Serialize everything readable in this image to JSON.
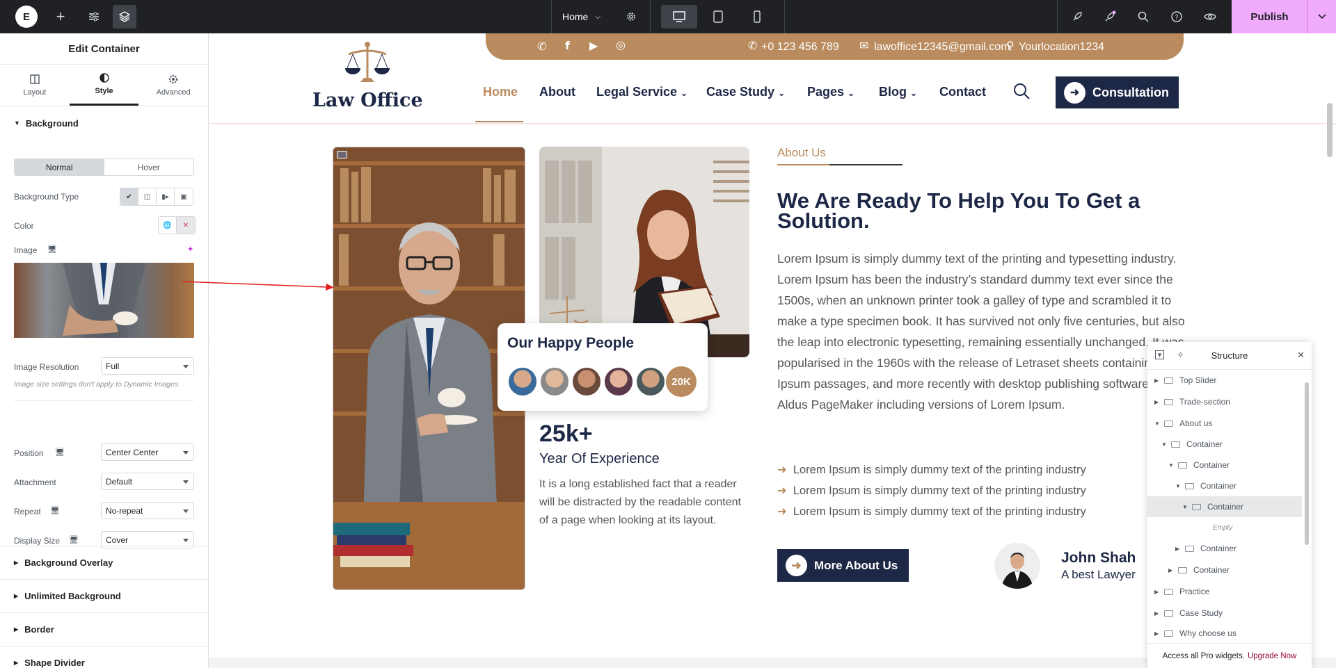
{
  "topbar": {
    "logo": "E",
    "page_name": "Home",
    "publish": "Publish"
  },
  "panel": {
    "title": "Edit Container",
    "tabs": [
      {
        "label": "Layout"
      },
      {
        "label": "Style"
      },
      {
        "label": "Advanced"
      }
    ],
    "background_section": "Background",
    "normal": "Normal",
    "hover": "Hover",
    "background_type_label": "Background Type",
    "color_label": "Color",
    "image_label": "Image",
    "image_resolution_label": "Image Resolution",
    "image_resolution_value": "Full",
    "image_note": "Image size settings don't apply to Dynamic Images.",
    "position_label": "Position",
    "position_value": "Center Center",
    "attachment_label": "Attachment",
    "attachment_value": "Default",
    "repeat_label": "Repeat",
    "repeat_value": "No-repeat",
    "display_size_label": "Display Size",
    "display_size_value": "Cover",
    "sections": [
      "Background Overlay",
      "Unlimited Background",
      "Border",
      "Shape Divider"
    ]
  },
  "site": {
    "phone": "+0 123 456 789",
    "email": "lawoffice12345@gmail.com",
    "location": "Yourlocation1234",
    "brand": "Law Office",
    "nav": [
      "Home",
      "About",
      "Legal Service",
      "Case Study",
      "Pages",
      "Blog",
      "Contact"
    ],
    "consultation": "Consultation",
    "happy_title": "Our Happy People",
    "happy_count": "20K",
    "exp_number": "25k+",
    "exp_label": "Year Of Experience",
    "exp_text": "It is a long established fact that a reader will be distracted by the readable content of a page when looking at its layout.",
    "about_tag": "About Us",
    "about_heading": "We Are Ready To Help You To Get a Solution.",
    "about_paragraph": "Lorem Ipsum is simply dummy text of the printing and typesetting industry. Lorem Ipsum has been the industry’s standard dummy text ever since the 1500s, when an unknown printer took a galley of type and scrambled it to make a type specimen book. It has survived not only five centuries, but also the leap into electronic typesetting, remaining essentially unchanged. It was popularised in the 1960s with the release of Letraset sheets containing Lorem Ipsum passages, and more recently with desktop publishing software like Aldus PageMaker including versions of Lorem Ipsum.",
    "bullets": [
      "Lorem Ipsum is simply dummy text of the printing industry",
      "Lorem Ipsum is simply dummy text of the printing industry",
      "Lorem Ipsum is simply dummy text of the printing industry"
    ],
    "more_button": "More About Us",
    "lawyer_name": "John Shah",
    "lawyer_role": "A best Lawyer"
  },
  "structure": {
    "title": "Structure",
    "items": [
      {
        "label": "Top Slider"
      },
      {
        "label": "Trade-section"
      },
      {
        "label": "About us"
      },
      {
        "label": "Container"
      },
      {
        "label": "Container"
      },
      {
        "label": "Container"
      },
      {
        "label": "Container"
      },
      {
        "label": "Empty"
      },
      {
        "label": "Container"
      },
      {
        "label": "Container"
      },
      {
        "label": "Practice"
      },
      {
        "label": "Case Study"
      },
      {
        "label": "Why choose us"
      }
    ],
    "footer_text": "Access all Pro widgets.",
    "footer_link": "Upgrade Now"
  },
  "colors": {
    "accent": "#b98b5e",
    "navy": "#1d2746",
    "publish": "#f0abfc",
    "editor_dark": "#1f2124"
  }
}
